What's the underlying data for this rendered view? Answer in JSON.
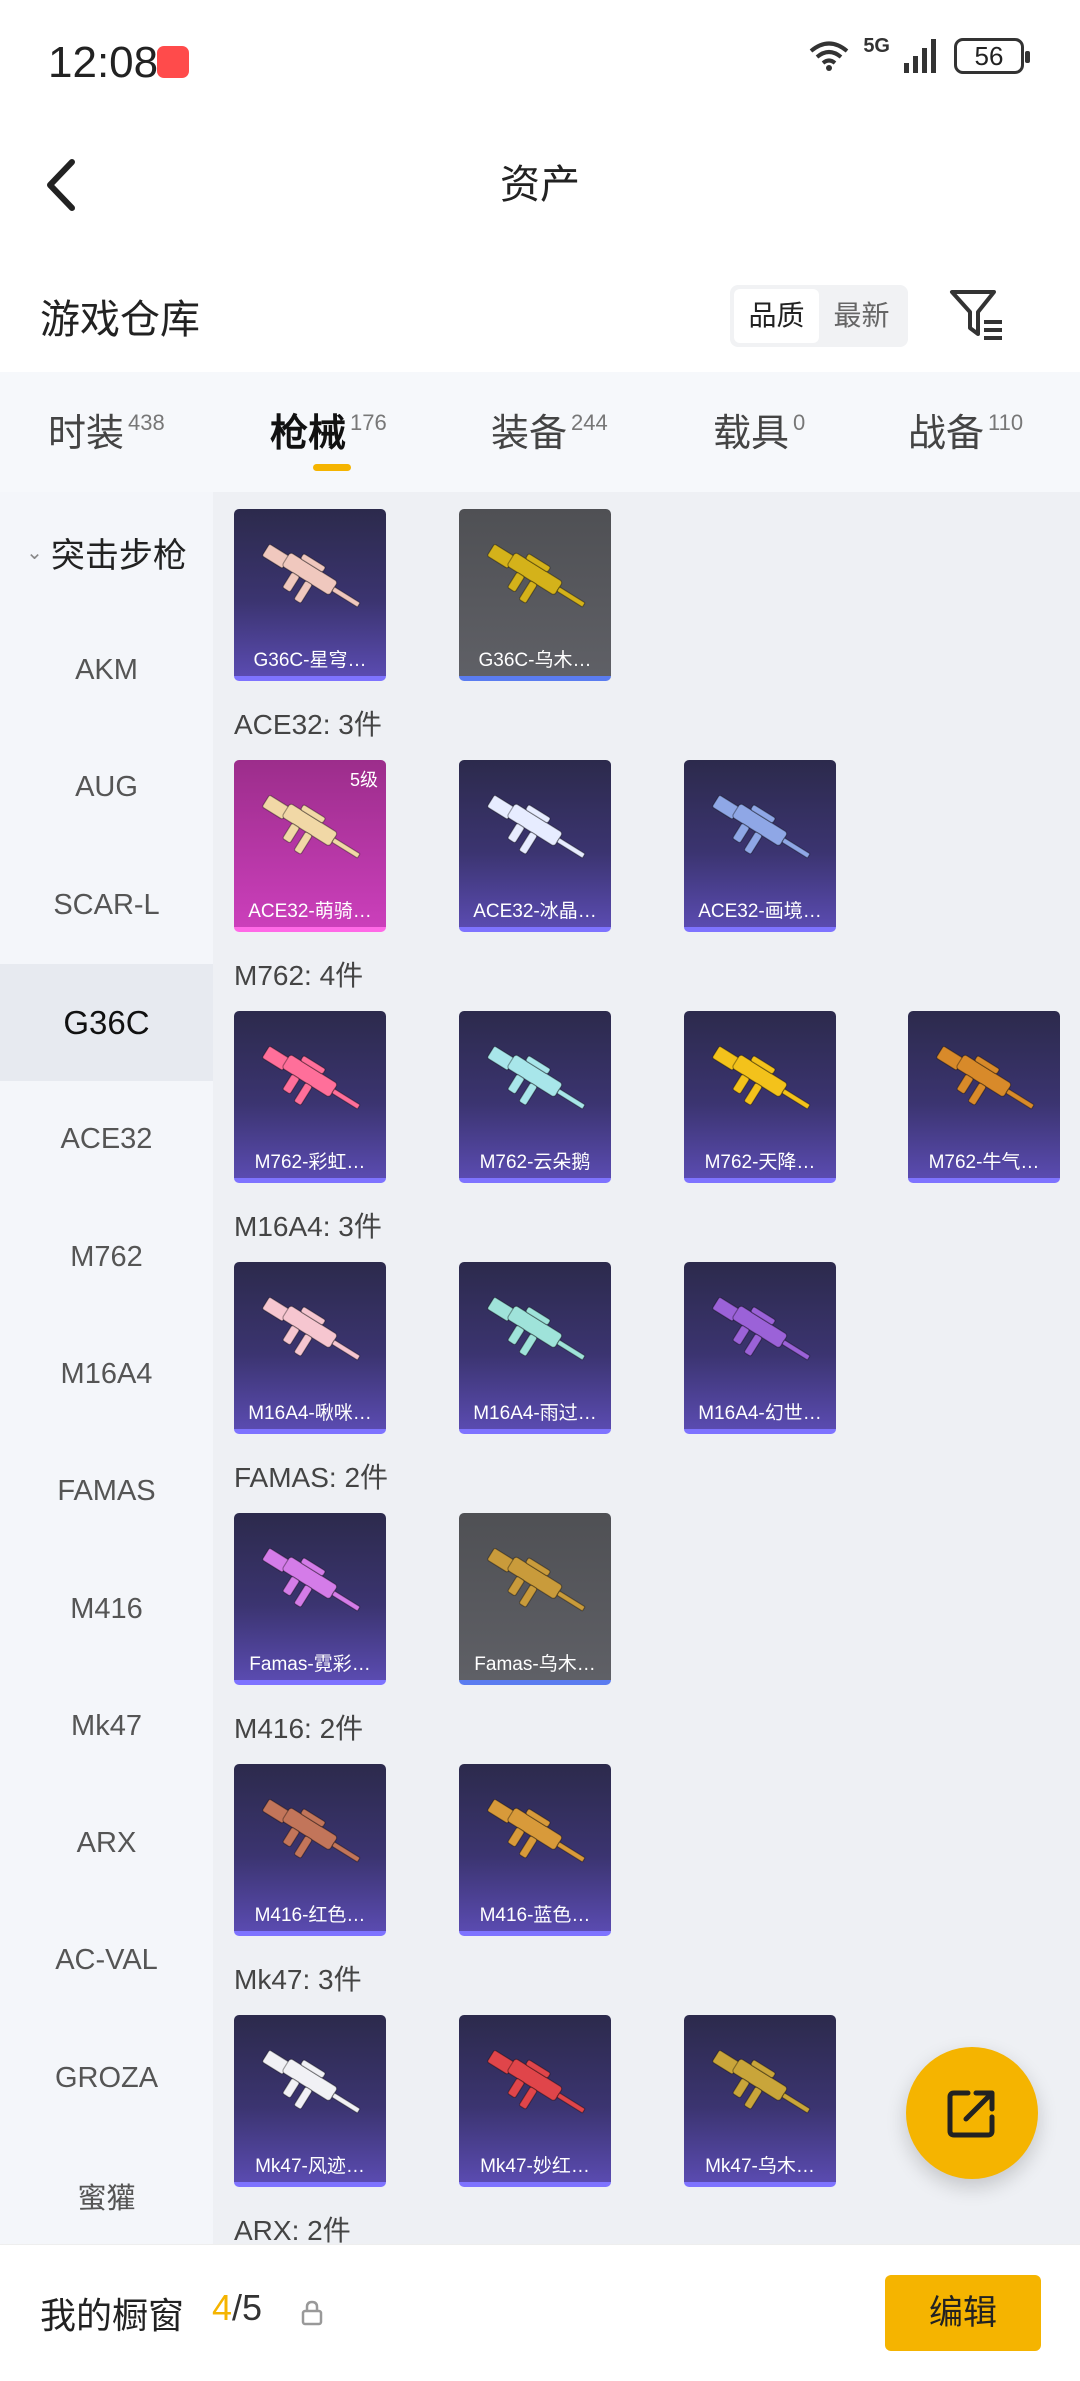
{
  "status_bar": {
    "time": "12:08",
    "network": "5G",
    "battery": "56"
  },
  "nav": {
    "title": "资产"
  },
  "header": {
    "section_title": "游戏仓库",
    "sort_quality": "品质",
    "sort_latest": "最新"
  },
  "tabs": [
    {
      "label": "时装",
      "count": "438"
    },
    {
      "label": "枪械",
      "count": "176"
    },
    {
      "label": "装备",
      "count": "244"
    },
    {
      "label": "载具",
      "count": "0"
    },
    {
      "label": "战备",
      "count": "110"
    }
  ],
  "active_tab": "枪械",
  "sidebar": {
    "group": "突击步枪",
    "items": [
      "AKM",
      "AUG",
      "SCAR-L",
      "G36C",
      "ACE32",
      "M762",
      "M16A4",
      "FAMAS",
      "M416",
      "Mk47",
      "ARX",
      "AC-VAL",
      "GROZA",
      "蜜獾"
    ],
    "active_item": "G36C"
  },
  "groups": [
    {
      "title": "",
      "items": [
        {
          "label": "G36C-星穹…",
          "style": "purple",
          "gun_color": "#f0c8be"
        },
        {
          "label": "G36C-乌木…",
          "style": "gray",
          "gun_color": "#d4b21a"
        }
      ]
    },
    {
      "title": "ACE32: 3件",
      "items": [
        {
          "label": "ACE32-萌骑…",
          "style": "pink",
          "badge": "5级",
          "gun_color": "#f1d8a6"
        },
        {
          "label": "ACE32-冰晶…",
          "style": "purple",
          "gun_color": "#e7ecff"
        },
        {
          "label": "ACE32-画境…",
          "style": "purple",
          "gun_color": "#8fa7e6"
        }
      ]
    },
    {
      "title": "M762: 4件",
      "items": [
        {
          "label": "M762-彩虹…",
          "style": "purple",
          "gun_color": "#ff6f9a"
        },
        {
          "label": "M762-云朵鹅",
          "style": "purple",
          "gun_color": "#a8e6ea"
        },
        {
          "label": "M762-天降…",
          "style": "purple",
          "gun_color": "#f3c21b"
        },
        {
          "label": "M762-牛气…",
          "style": "purple",
          "gun_color": "#d88a2a"
        }
      ]
    },
    {
      "title": "M16A4: 3件",
      "items": [
        {
          "label": "M16A4-啾咪…",
          "style": "purple",
          "gun_color": "#f6c6d0"
        },
        {
          "label": "M16A4-雨过…",
          "style": "purple",
          "gun_color": "#9fe3da"
        },
        {
          "label": "M16A4-幻世…",
          "style": "purple",
          "gun_color": "#9b62d8"
        }
      ]
    },
    {
      "title": "FAMAS: 2件",
      "items": [
        {
          "label": "Famas-霓彩…",
          "style": "purple",
          "gun_color": "#d47ce8"
        },
        {
          "label": "Famas-乌木…",
          "style": "gray",
          "gun_color": "#c99b3b"
        }
      ]
    },
    {
      "title": "M416: 2件",
      "items": [
        {
          "label": "M416-红色…",
          "style": "purple",
          "gun_color": "#c2755a"
        },
        {
          "label": "M416-蓝色…",
          "style": "purple",
          "gun_color": "#d89a3a"
        }
      ]
    },
    {
      "title": "Mk47: 3件",
      "items": [
        {
          "label": "Mk47-风迹…",
          "style": "purple",
          "gun_color": "#f1f1f5"
        },
        {
          "label": "Mk47-妙红…",
          "style": "purple",
          "gun_color": "#e0454a"
        },
        {
          "label": "Mk47-乌木…",
          "style": "purple",
          "gun_color": "#c9a53a"
        }
      ]
    },
    {
      "title": "ARX: 2件",
      "items": []
    }
  ],
  "bottom": {
    "showcase_label": "我的橱窗",
    "current": "4",
    "total": "5",
    "edit_label": "编辑"
  },
  "colors": {
    "accent": "#f5b400",
    "card_purple": "#3b3470",
    "card_gray": "#55565b",
    "card_pink": "#cb3fbb"
  }
}
